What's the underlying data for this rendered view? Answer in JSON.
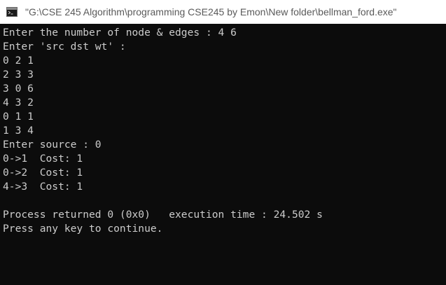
{
  "window": {
    "title": "\"G:\\CSE 245 Algorithm\\programming CSE245 by Emon\\New folder\\bellman_ford.exe\""
  },
  "console": {
    "lines": [
      "Enter the number of node & edges : 4 6",
      "Enter 'src dst wt' :",
      "0 2 1",
      "2 3 3",
      "3 0 6",
      "4 3 2",
      "0 1 1",
      "1 3 4",
      "Enter source : 0",
      "0->1  Cost: 1",
      "0->2  Cost: 1",
      "4->3  Cost: 1",
      "",
      "Process returned 0 (0x0)   execution time : 24.502 s",
      "Press any key to continue."
    ]
  },
  "icons": {
    "app": "console-window-icon"
  },
  "colors": {
    "console_background": "#0c0c0c",
    "console_text": "#cccccc",
    "titlebar_background": "#ffffff",
    "title_text": "#5a5a5a"
  }
}
